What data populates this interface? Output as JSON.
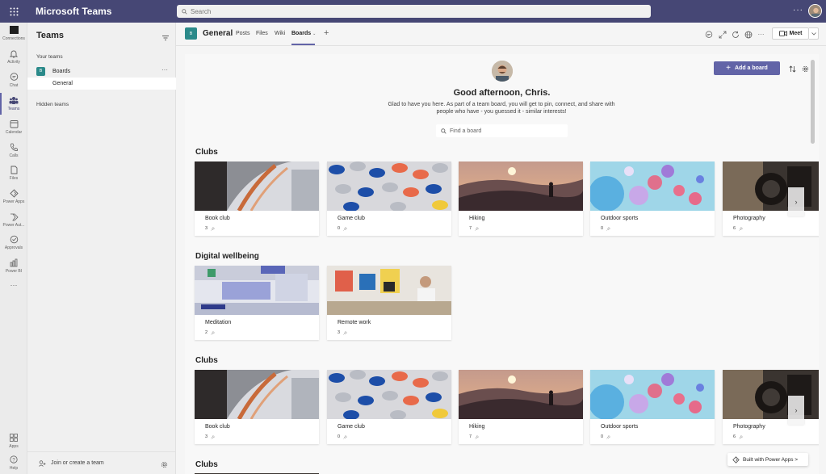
{
  "app": {
    "title": "Microsoft Teams",
    "search_placeholder": "Search",
    "more_label": "···"
  },
  "rail": {
    "items": [
      {
        "label": "Connections",
        "icon": "connections-icon"
      },
      {
        "label": "Activity",
        "icon": "bell-icon"
      },
      {
        "label": "Chat",
        "icon": "chat-icon"
      },
      {
        "label": "Teams",
        "icon": "teams-icon",
        "active": true
      },
      {
        "label": "Calendar",
        "icon": "calendar-icon"
      },
      {
        "label": "Calls",
        "icon": "phone-icon"
      },
      {
        "label": "Files",
        "icon": "file-icon"
      },
      {
        "label": "Power Apps",
        "icon": "power-apps-icon"
      },
      {
        "label": "Power Aut...",
        "icon": "power-automate-icon"
      },
      {
        "label": "Approvals",
        "icon": "approvals-icon"
      },
      {
        "label": "Power BI",
        "icon": "power-bi-icon"
      }
    ],
    "more": "···",
    "apps_label": "Apps",
    "help_label": "Help"
  },
  "teams_panel": {
    "title": "Teams",
    "your_teams_label": "Your teams",
    "team": {
      "initial": "B",
      "name": "Boards",
      "more": "···"
    },
    "channel": "General",
    "hidden_teams_label": "Hidden teams",
    "join_label": "Join or create a team"
  },
  "channel_header": {
    "initial": "B",
    "name": "General",
    "tabs": [
      "Posts",
      "Files",
      "Wiki",
      "Boards"
    ],
    "active_tab": "Boards",
    "add_tab": "+",
    "meet_label": "Meet",
    "more_label": "···"
  },
  "boards": {
    "greeting": "Good afternoon, Chris.",
    "intro": "Glad to have you here. As part of a team board, you will get to pin, connect, and share with people who have - you guessed it - similar interests!",
    "find_placeholder": "Find a board",
    "add_board_label": "Add a board",
    "sections": [
      {
        "title": "Clubs",
        "cards": [
          {
            "name": "Book club",
            "count": "3",
            "image": "book-club-image"
          },
          {
            "name": "Game club",
            "count": "0",
            "image": "game-club-image"
          },
          {
            "name": "Hiking",
            "count": "7",
            "image": "hiking-image"
          },
          {
            "name": "Outdoor sports",
            "count": "0",
            "image": "outdoor-sports-image"
          },
          {
            "name": "Photography",
            "count": "6",
            "image": "photography-image"
          }
        ]
      },
      {
        "title": "Digital wellbeing",
        "cards": [
          {
            "name": "Meditation",
            "count": "2",
            "image": "meditation-image"
          },
          {
            "name": "Remote work",
            "count": "3",
            "image": "remote-work-image"
          }
        ]
      },
      {
        "title": "Clubs",
        "cards": [
          {
            "name": "Book club",
            "count": "3",
            "image": "book-club-image"
          },
          {
            "name": "Game club",
            "count": "0",
            "image": "game-club-image"
          },
          {
            "name": "Hiking",
            "count": "7",
            "image": "hiking-image"
          },
          {
            "name": "Outdoor sports",
            "count": "0",
            "image": "outdoor-sports-image"
          },
          {
            "name": "Photography",
            "count": "6",
            "image": "photography-image"
          }
        ]
      },
      {
        "title": "Clubs",
        "cards": []
      }
    ],
    "built_with_label": "Built with Power Apps >"
  },
  "colors": {
    "topbar": "#464775",
    "accent": "#6264a7",
    "team_avatar": "#2b8a8a"
  }
}
